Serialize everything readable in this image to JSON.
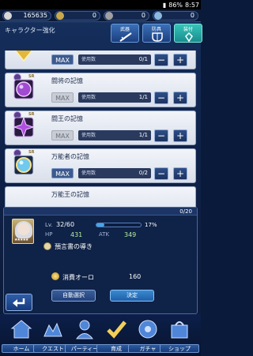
{
  "status_bar": {
    "battery": "86%",
    "time": "8:57"
  },
  "resources": [
    {
      "value": "165635",
      "icon": "gil-coin-icon",
      "color": "#d8d8d8"
    },
    {
      "value": "0",
      "icon": "gem-icon",
      "color": "#c9a94c"
    },
    {
      "value": "0",
      "icon": "paid-gem-icon",
      "color": "#a0a0a0"
    },
    {
      "value": "0",
      "icon": "ticket-icon",
      "color": "#8cb9e0"
    }
  ],
  "header": {
    "title": "キャラクター強化"
  },
  "categories": [
    {
      "label": "武器",
      "icon": "sword-icon"
    },
    {
      "label": "防具",
      "icon": "armor-icon"
    },
    {
      "label": "装付",
      "icon": "accessory-icon"
    }
  ],
  "items": [
    {
      "name": "",
      "max": "MAX",
      "use_label": "使用数",
      "count": "0/1",
      "minus": "−",
      "plus": "+",
      "color": "#e3b73b"
    },
    {
      "name": "闘将の記憶",
      "max": "MAX",
      "use_label": "使用数",
      "count": "1/1",
      "minus": "−",
      "plus": "+",
      "color": "#a14ad2",
      "rarity": "SR"
    },
    {
      "name": "闘王の記憶",
      "max": "MAX",
      "use_label": "使用数",
      "count": "1/1",
      "minus": "−",
      "plus": "+",
      "color": "#b04fe0",
      "rarity": "SR"
    },
    {
      "name": "万能者の記憶",
      "max": "MAX",
      "use_label": "使用数",
      "count": "0/2",
      "minus": "−",
      "plus": "+",
      "color": "#6fc9f0",
      "rarity": "SR"
    },
    {
      "name": "万能王の記憶"
    }
  ],
  "panel": {
    "count": "0/20",
    "level_label": "Lv.",
    "level": "32",
    "level_max": "60",
    "level_progress": 0.17,
    "level_pct": "17%",
    "hp_label": "HP",
    "hp": "431",
    "atk_label": "ATK",
    "atk": "349",
    "skill": "預言書の導き",
    "cost_label": "消費オーロ",
    "cost_value": "160",
    "auto_button": "自動選択",
    "decide_button": "決定",
    "card_stars": "★★★★★"
  },
  "nav": [
    {
      "label": "ホーム",
      "icon": "home-icon"
    },
    {
      "label": "クエスト",
      "icon": "quest-icon"
    },
    {
      "label": "パーティー",
      "icon": "party-icon"
    },
    {
      "label": "育成",
      "icon": "training-icon"
    },
    {
      "label": "ガチャ",
      "icon": "gacha-icon"
    },
    {
      "label": "ショップ",
      "icon": "shop-icon"
    }
  ]
}
